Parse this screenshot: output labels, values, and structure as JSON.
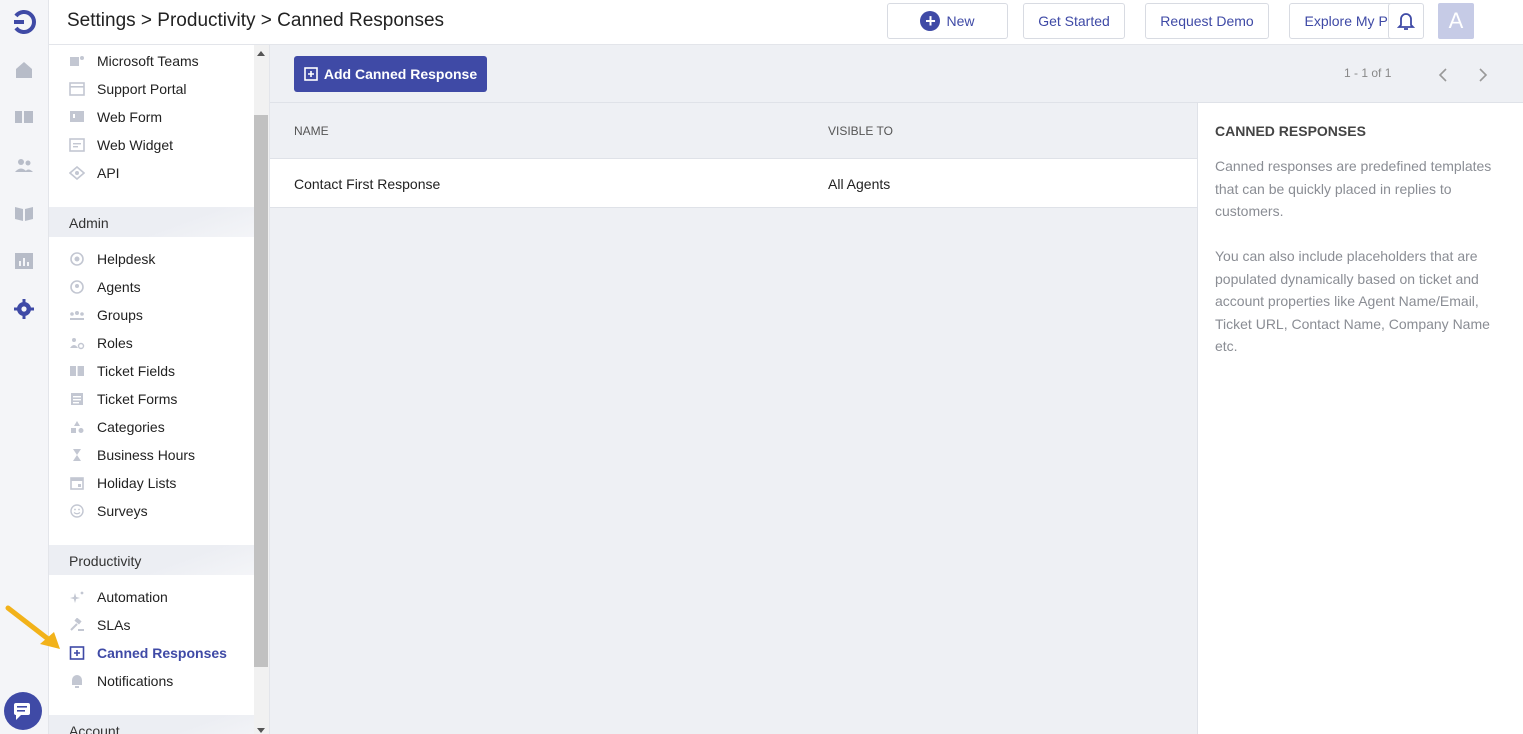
{
  "header": {
    "breadcrumb": "Settings > Productivity > Canned Responses",
    "buttons": {
      "new": "New",
      "get_started": "Get Started",
      "request_demo": "Request Demo",
      "explore_plan": "Explore My Plan"
    },
    "avatar_letter": "A"
  },
  "rail": {
    "icons": [
      "home-icon",
      "ticket-icon",
      "contacts-icon",
      "knowledge-base-icon",
      "reports-icon",
      "settings-icon"
    ]
  },
  "sidebar": {
    "channels": [
      "Microsoft Teams",
      "Support Portal",
      "Web Form",
      "Web Widget",
      "API"
    ],
    "admin_title": "Admin",
    "admin": [
      "Helpdesk",
      "Agents",
      "Groups",
      "Roles",
      "Ticket Fields",
      "Ticket Forms",
      "Categories",
      "Business Hours",
      "Holiday Lists",
      "Surveys"
    ],
    "productivity_title": "Productivity",
    "productivity": [
      "Automation",
      "SLAs",
      "Canned Responses",
      "Notifications"
    ],
    "account_title": "Account"
  },
  "main": {
    "add_button": "Add Canned Response",
    "pagination": "1 - 1 of 1",
    "columns": [
      "NAME",
      "VISIBLE TO"
    ],
    "rows": [
      {
        "name": "Contact First Response",
        "visible_to": "All Agents"
      }
    ]
  },
  "info": {
    "title": "CANNED RESPONSES",
    "p1": "Canned responses are predefined templates that can be quickly placed in replies to customers.",
    "p2": "You can also include placeholders that are populated dynamically based on ticket and account properties like Agent Name/Email, Ticket URL, Contact Name, Company Name etc."
  },
  "colors": {
    "accent": "#3f4aa6",
    "annotation": "#f2b21a"
  }
}
